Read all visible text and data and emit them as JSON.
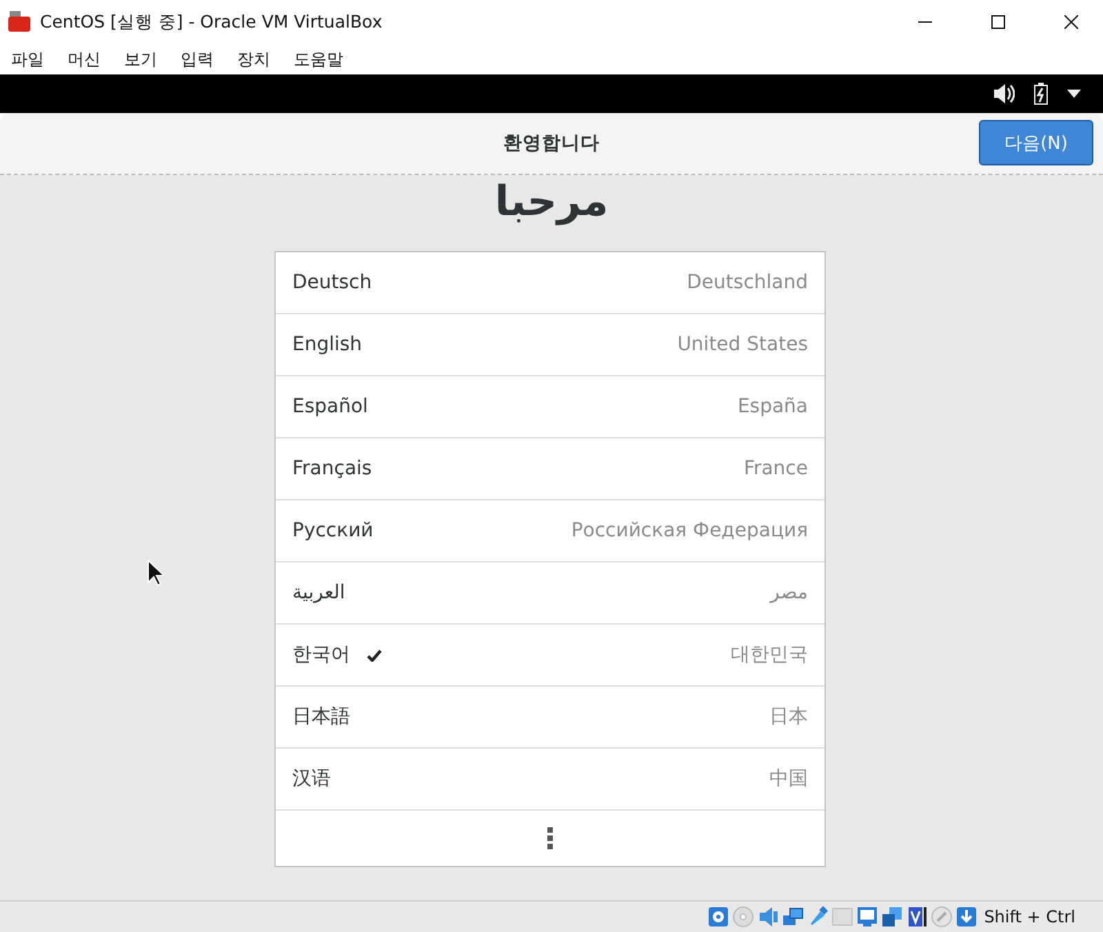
{
  "window": {
    "title": "CentOS [실행 중] - Oracle VM VirtualBox"
  },
  "menu": [
    "파일",
    "머신",
    "보기",
    "입력",
    "장치",
    "도움말"
  ],
  "header": {
    "title": "환영합니다",
    "next_button": "다음(N)"
  },
  "heading": "مرحبا",
  "languages": [
    {
      "name": "Deutsch",
      "region": "Deutschland",
      "selected": false
    },
    {
      "name": "English",
      "region": "United States",
      "selected": false
    },
    {
      "name": "Español",
      "region": "España",
      "selected": false
    },
    {
      "name": "Français",
      "region": "France",
      "selected": false
    },
    {
      "name": "Русский",
      "region": "Российская Федерация",
      "selected": false
    },
    {
      "name": "العربية",
      "region": "مصر",
      "selected": false
    },
    {
      "name": "한국어",
      "region": "대한민국",
      "selected": true
    },
    {
      "name": "日本語",
      "region": "日本",
      "selected": false
    },
    {
      "name": "汉语",
      "region": "中国",
      "selected": false
    }
  ],
  "status_bar": {
    "host_key": "Shift + Ctrl"
  }
}
